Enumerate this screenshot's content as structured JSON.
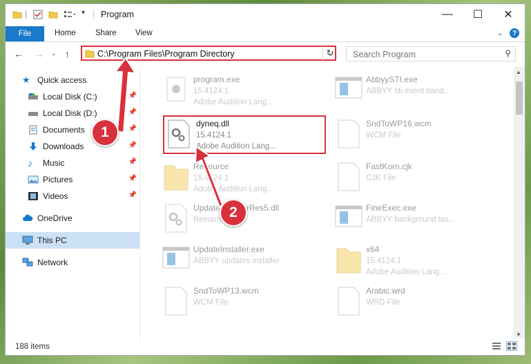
{
  "window": {
    "title": "Program",
    "minimize_glyph": "—",
    "maximize_glyph": "☐",
    "close_glyph": "✕"
  },
  "ribbon": {
    "tabs": [
      "File",
      "Home",
      "Share",
      "View"
    ],
    "help_label": "?"
  },
  "nav": {
    "back_glyph": "←",
    "forward_glyph": "→",
    "up_glyph": "↑",
    "address": "C:\\Program Files\\Program Directory",
    "refresh_glyph": "↻",
    "search_placeholder": "Search Program"
  },
  "sidebar": {
    "items": [
      {
        "label": "Quick access",
        "icon": "star-icon"
      },
      {
        "label": "Local Disk (C:)",
        "icon": "drive-icon"
      },
      {
        "label": "Local Disk (D:)",
        "icon": "drive-icon"
      },
      {
        "label": "Documents",
        "icon": "documents-icon"
      },
      {
        "label": "Downloads",
        "icon": "download-icon"
      },
      {
        "label": "Music",
        "icon": "music-icon"
      },
      {
        "label": "Pictures",
        "icon": "pictures-icon"
      },
      {
        "label": "Videos",
        "icon": "videos-icon"
      },
      {
        "label": "OneDrive",
        "icon": "cloud-icon"
      },
      {
        "label": "This PC",
        "icon": "computer-icon"
      },
      {
        "label": "Network",
        "icon": "network-icon"
      }
    ]
  },
  "files": [
    {
      "name": "program.exe",
      "version": "15.4124.1",
      "desc": "Adobe Audition Lang...",
      "icon": "exe-icon"
    },
    {
      "name": "AbbyySTI.exe",
      "version": "",
      "desc": "ABBYY sti event hand...",
      "icon": "app-window-icon"
    },
    {
      "name": "dyneq.dll",
      "version": "15.4124.1",
      "desc": "Adobe Audition Lang...",
      "icon": "dll-gear-icon"
    },
    {
      "name": "SndToWP16.wcm",
      "version": "",
      "desc": "WCM File",
      "icon": "blank-file-icon"
    },
    {
      "name": "Resource",
      "version": "15.4124.1",
      "desc": "Adobe Audition Lang...",
      "icon": "folder-icon"
    },
    {
      "name": "FastKorn.cjk",
      "version": "",
      "desc": "CJK File",
      "icon": "blank-file-icon"
    },
    {
      "name": "UpdateInstallerRes5.dll",
      "version": "",
      "desc": "Resource DLL",
      "icon": "dll-gear-icon"
    },
    {
      "name": "FineExec.exe",
      "version": "",
      "desc": "ABBYY background tas...",
      "icon": "app-window-icon"
    },
    {
      "name": "UpdateInstaller.exe",
      "version": "",
      "desc": "ABBYY updates installer",
      "icon": "app-window-icon"
    },
    {
      "name": "x64",
      "version": "15.4124.1",
      "desc": "Adobe Audition Lang...",
      "icon": "folder-icon"
    },
    {
      "name": "SndToWP13.wcm",
      "version": "",
      "desc": "WCM File",
      "icon": "blank-file-icon"
    },
    {
      "name": "Arabic.wrd",
      "version": "",
      "desc": "WRD File",
      "icon": "blank-file-icon"
    }
  ],
  "status": {
    "count": "188 items"
  },
  "annotations": {
    "step1": "1",
    "step2": "2"
  },
  "colors": {
    "accent": "#1979ca",
    "highlight_red": "#d9303e",
    "selected_bg": "#cce1f5"
  }
}
